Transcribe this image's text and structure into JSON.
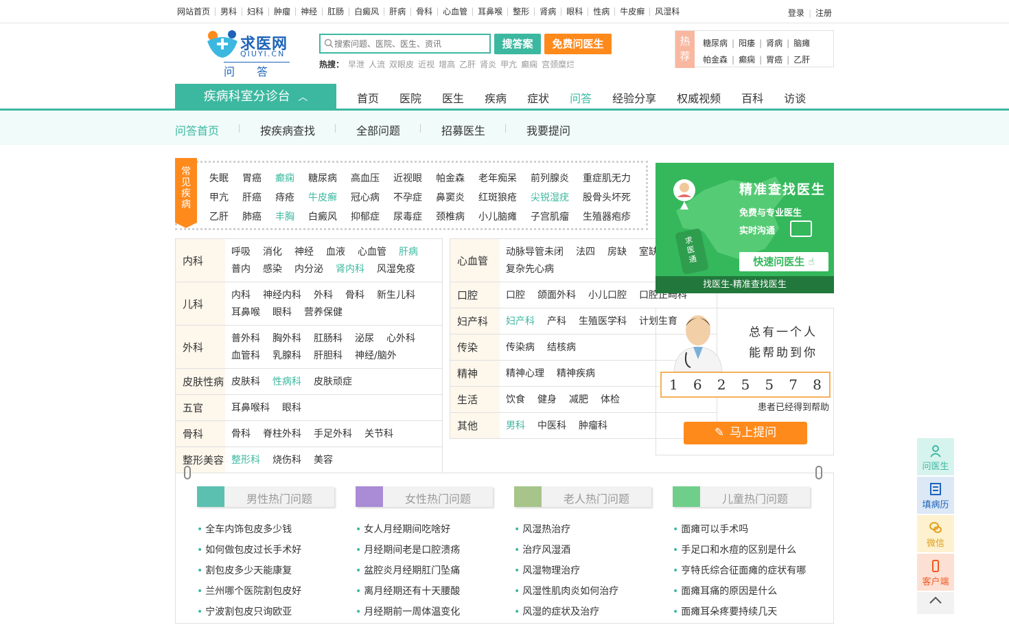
{
  "topnav": [
    "网站首页",
    "男科",
    "妇科",
    "肿瘤",
    "神经",
    "肛肠",
    "白癜风",
    "肝病",
    "骨科",
    "心血管",
    "耳鼻喉",
    "整形",
    "肾病",
    "眼科",
    "性病",
    "牛皮癣",
    "风湿科"
  ],
  "account": {
    "login": "登录",
    "register": "注册"
  },
  "logo": {
    "name": "求医网",
    "en": "QIUYI.CN",
    "sub": "问答"
  },
  "search": {
    "placeholder": "搜索问题、医院、医生、资讯",
    "search_btn": "搜答案",
    "ask_btn": "免费问医生"
  },
  "hotsearch": {
    "label": "热搜：",
    "items": [
      "早泄",
      "人流",
      "双眼皮",
      "近视",
      "增高",
      "乙肝",
      "肾炎",
      "甲亢",
      "癫痫",
      "宫颈糜烂"
    ]
  },
  "recommend": {
    "label": "热荐",
    "row1": [
      "糖尿病",
      "阳痿",
      "肾病",
      "脑瘫"
    ],
    "row2": [
      "帕金森",
      "癫痫",
      "胃癌",
      "乙肝"
    ]
  },
  "mainnav": {
    "dept_btn": "疾病科室分诊台",
    "links": [
      "首页",
      "医院",
      "医生",
      "疾病",
      "症状",
      "问答",
      "经验分享",
      "权威视频",
      "百科",
      "访谈"
    ],
    "active": "问答"
  },
  "subnav": [
    "问答首页",
    "按疾病查找",
    "全部问题",
    "招募医生",
    "我要提问"
  ],
  "common": {
    "tag": "常见疾病",
    "rows": [
      [
        "失眠",
        "胃癌",
        "癫痫",
        "糖尿病",
        "高血压",
        "近视眼",
        "帕金森",
        "老年痴呆",
        "前列腺炎",
        "重症肌无力"
      ],
      [
        "甲亢",
        "肝癌",
        "痔疮",
        "牛皮癣",
        "冠心病",
        "不孕症",
        "鼻窦炎",
        "红斑狼疮",
        "尖锐湿疣",
        "股骨头坏死"
      ],
      [
        "乙肝",
        "肺癌",
        "丰胸",
        "白癜风",
        "抑郁症",
        "尿毒症",
        "颈椎病",
        "小儿脑瘫",
        "子宫肌瘤",
        "生殖器疱疹"
      ]
    ],
    "highlighted": [
      "癫痫",
      "牛皮癣",
      "尖锐湿疣",
      "丰胸"
    ]
  },
  "depts_left": [
    {
      "label": "内科",
      "items": [
        "呼吸",
        "消化",
        "神经",
        "血液",
        "心血管",
        "肝病",
        "普内",
        "感染",
        "内分泌",
        "肾内科",
        "风湿免疫"
      ]
    },
    {
      "label": "儿科",
      "items": [
        "内科",
        "神经内科",
        "外科",
        "骨科",
        "新生儿科",
        "耳鼻喉",
        "眼科",
        "营养保健"
      ]
    },
    {
      "label": "外科",
      "items": [
        "普外科",
        "胸外科",
        "肛肠科",
        "泌尿",
        "心外科",
        "血管科",
        "乳腺科",
        "肝胆科",
        "神经/脑外"
      ]
    },
    {
      "label": "皮肤性病",
      "items": [
        "皮肤科",
        "性病科",
        "皮肤顽症"
      ]
    },
    {
      "label": "五官",
      "items": [
        "耳鼻喉科",
        "眼科"
      ]
    },
    {
      "label": "骨科",
      "items": [
        "骨科",
        "脊柱外科",
        "手足外科",
        "关节科"
      ]
    },
    {
      "label": "整形美容",
      "items": [
        "整形科",
        "烧伤科",
        "美容"
      ]
    }
  ],
  "depts_right": [
    {
      "label": "心血管",
      "items": [
        "动脉导管未闭",
        "法四",
        "房缺",
        "室缺",
        "复杂先心病"
      ]
    },
    {
      "label": "口腔",
      "items": [
        "口腔",
        "颌面外科",
        "小儿口腔",
        "口腔正畸科"
      ]
    },
    {
      "label": "妇产科",
      "items": [
        "妇产科",
        "产科",
        "生殖医学科",
        "计划生育"
      ]
    },
    {
      "label": "传染",
      "items": [
        "传染病",
        "结核病"
      ]
    },
    {
      "label": "精神",
      "items": [
        "精神心理",
        "精神疾病"
      ]
    },
    {
      "label": "生活",
      "items": [
        "饮食",
        "健身",
        "减肥",
        "体检"
      ]
    },
    {
      "label": "其他",
      "items": [
        "男科",
        "中医科",
        "肿瘤科"
      ]
    }
  ],
  "dept_highlighted": [
    "肝病",
    "肾内科",
    "性病科",
    "整形科",
    "妇产科",
    "男科"
  ],
  "finddoc": {
    "title": "精准查找医生",
    "line1": "免费与专业医生",
    "line2": "实时沟通",
    "btn": "快速问医生",
    "caption": "找医生-精准查找医生",
    "phone_text": "求医通"
  },
  "helpbox": {
    "line1": "总有一个人",
    "line2": "能帮助到你",
    "digits": [
      "1",
      "6",
      "2",
      "5",
      "5",
      "7",
      "8"
    ],
    "caption": "患者已经得到帮助",
    "btn": "马上提问"
  },
  "hot": [
    {
      "title": "男性热门问题",
      "color": "#5cc0b0",
      "items": [
        "全车内饰包皮多少钱",
        "如何做包皮过长手术好",
        "割包皮多少天能康复",
        "兰州哪个医院割包皮好",
        "宁波割包皮只询欧亚"
      ]
    },
    {
      "title": "女性热门问题",
      "color": "#a98bd6",
      "items": [
        "女人月经期间吃啥好",
        "月经期间老是口腔溃疡",
        "盆腔炎月经期肛门坠痛",
        "离月经期还有十天腰酸",
        "月经期前一周体温变化"
      ]
    },
    {
      "title": "老人热门问题",
      "color": "#a7c48a",
      "items": [
        "风湿热治疗",
        "治疗风湿酒",
        "风湿物理治疗",
        "风湿性肌肉炎如何治疗",
        "风湿的症状及治疗"
      ]
    },
    {
      "title": "儿童热门问题",
      "color": "#6fcf8a",
      "items": [
        "面瘫可以手术吗",
        "手足口和水痘的区别是什么",
        "亨特氏综合征面瘫的症状有哪",
        "面瘫耳痛的原因是什么",
        "面瘫耳朵疼要持续几天"
      ]
    }
  ],
  "floatbar": {
    "ask": "问医生",
    "record": "填病历",
    "wechat": "微信",
    "client": "客户端"
  },
  "colors": {
    "accent": "#3cb8a0",
    "orange": "#ff8a1c",
    "brand_blue": "#1e63b8"
  }
}
